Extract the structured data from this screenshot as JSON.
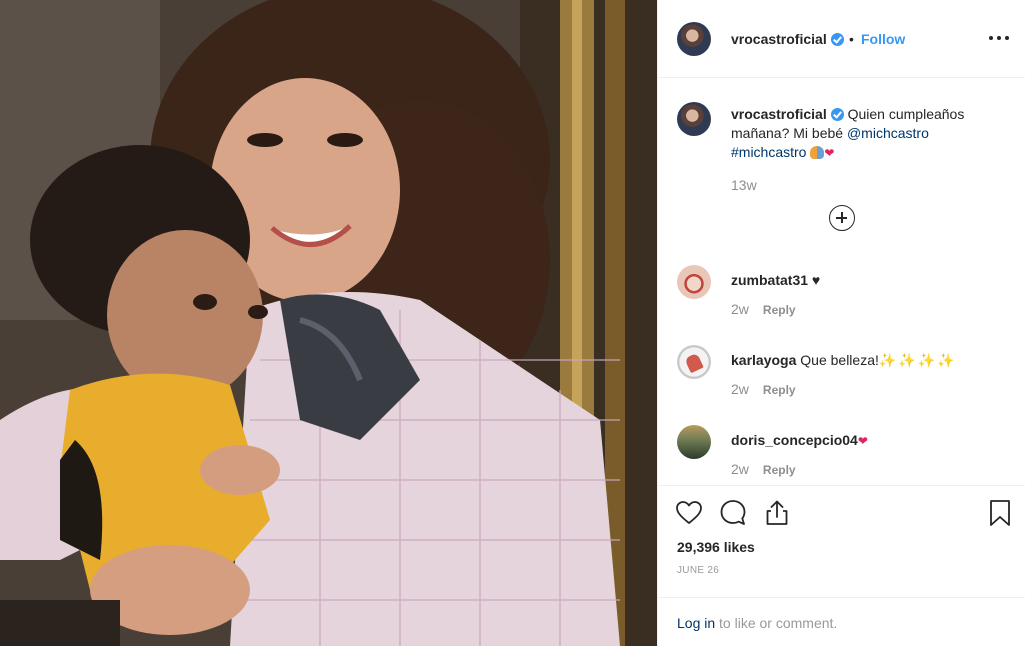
{
  "header": {
    "username": "vrocastroficial",
    "separator": "•",
    "follow_label": "Follow",
    "more_icon": "more-horizontal-icon"
  },
  "caption": {
    "username": "vrocastroficial",
    "text": "Quien cumpleaños mañana? Mi bebé",
    "mention": "@michcastro",
    "hashtag": "#michcastro",
    "time": "13w"
  },
  "comments": [
    {
      "username": "zumbatat31",
      "text": "♥",
      "time": "2w",
      "reply_label": "Reply"
    },
    {
      "username": "karlayoga",
      "text": "Que belleza!",
      "emoji": "✨✨✨✨",
      "time": "2w",
      "reply_label": "Reply"
    },
    {
      "username": "doris_concepcio04",
      "text": "❤",
      "time": "2w",
      "reply_label": "Reply"
    }
  ],
  "actions": {
    "likes": "29,396 likes",
    "date": "JUNE 26"
  },
  "login": {
    "link_label": "Log in",
    "text": " to like or comment."
  },
  "colors": {
    "accent": "#3897f0",
    "link": "#003569",
    "muted": "#8e8e8e",
    "border": "#efefef"
  }
}
